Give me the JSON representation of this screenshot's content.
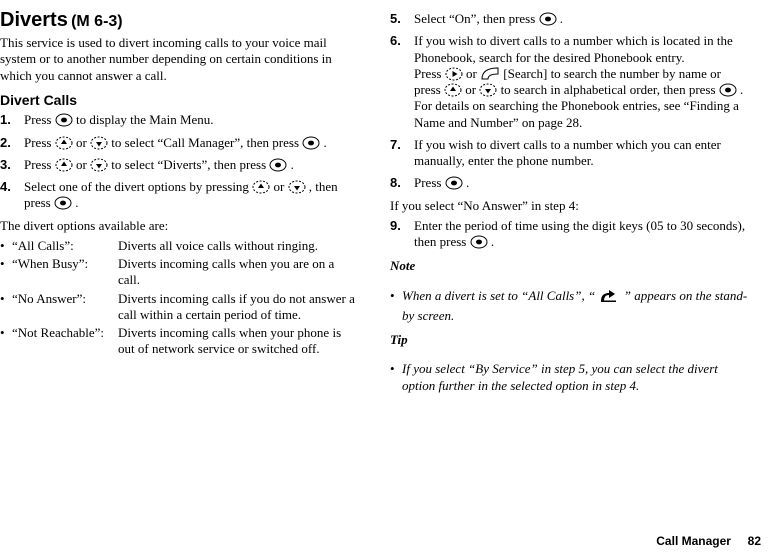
{
  "title": "Diverts",
  "title_code": "(M 6-3)",
  "intro": "This service is used to divert incoming calls to your voice mail system or to another number depending on certain conditions in which you cannot answer a call.",
  "subhead": "Divert Calls",
  "left_steps": {
    "s1_a": "Press ",
    "s1_b": " to display the Main Menu.",
    "s2_a": "Press ",
    "s2_b": " or ",
    "s2_c": " to select “Call Manager”, then press ",
    "s2_d": ".",
    "s3_a": "Press ",
    "s3_b": " or ",
    "s3_c": " to select “Diverts”, then press ",
    "s3_d": ".",
    "s4_a": "Select one of the divert options by pressing ",
    "s4_b": " or ",
    "s4_c": ", then press ",
    "s4_d": "."
  },
  "options_intro": "The divert options available are:",
  "options": [
    {
      "label": "“All Calls”:",
      "desc": "Diverts all voice calls without ringing."
    },
    {
      "label": "“When Busy”:",
      "desc": "Diverts incoming calls when you are on a call."
    },
    {
      "label": "“No Answer”:",
      "desc": "Diverts incoming calls if you do not answer a call within a certain period of time."
    },
    {
      "label": "“Not Reachable”:",
      "desc": "Diverts incoming calls when your phone is out of network service or switched off."
    }
  ],
  "right_steps": {
    "s5_a": "Select “On”, then press ",
    "s5_b": ".",
    "s6_a": "If you wish to divert calls to a number which is located in the Phonebook, search for the desired Phonebook entry.",
    "s6_b": "Press ",
    "s6_c": " or ",
    "s6_d": " [Search] to search the number by name or press ",
    "s6_e": " or ",
    "s6_f": " to search in alphabetical order, then press ",
    "s6_g": ". For details on searching the Phonebook entries, see “Finding a Name and Number” on page 28.",
    "s7": "If you wish to divert calls to a number which you can enter manually, enter the phone number.",
    "s8_a": "Press ",
    "s8_b": "."
  },
  "right_cond": "If you select “No Answer” in step 4:",
  "right_step9_a": "Enter the period of time using the digit keys (05 to 30 seconds), then press ",
  "right_step9_b": ".",
  "note_head": "Note",
  "note_a": "When a divert is set to “All Calls”, “",
  "note_b": "” appears on the stand-by screen.",
  "tip_head": "Tip",
  "tip": "If you select “By Service” in step 5, you can select the divert option further in the selected option in step 4.",
  "footer_label": "Call Manager",
  "footer_page": "82",
  "nums": {
    "n1": "1.",
    "n2": "2.",
    "n3": "3.",
    "n4": "4.",
    "n5": "5.",
    "n6": "6.",
    "n7": "7.",
    "n8": "8.",
    "n9": "9."
  },
  "bullet": "•"
}
